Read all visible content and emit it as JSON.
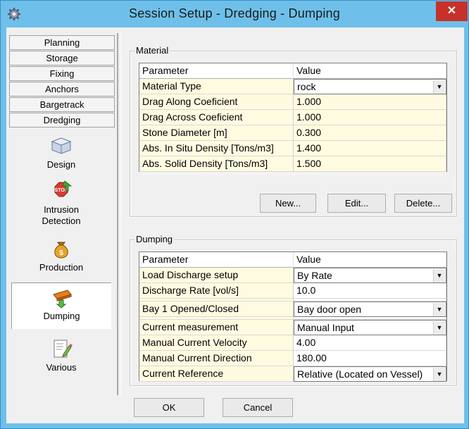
{
  "window": {
    "title": "Session Setup - Dredging -  Dumping",
    "close_glyph": "✕",
    "icon": "gear-icon"
  },
  "nav": {
    "tabs": [
      "Planning",
      "Storage",
      "Fixing",
      "Anchors",
      "Bargetrack",
      "Dredging"
    ],
    "items": [
      {
        "label": "Design",
        "icon": "design-box-icon"
      },
      {
        "label": "Intrusion\nDetection",
        "icon": "stop-sign-icon"
      },
      {
        "label": "Production",
        "icon": "money-bag-icon"
      },
      {
        "label": "Dumping",
        "icon": "dumping-arrow-icon",
        "selected": true
      },
      {
        "label": "Various",
        "icon": "pencil-checklist-icon"
      }
    ]
  },
  "material": {
    "title": "Material",
    "headers": [
      "Parameter",
      "Value"
    ],
    "rows": [
      {
        "param": "Material Type",
        "value": "rock",
        "dropdown": true
      },
      {
        "param": "Drag Along Coeficient",
        "value": "1.000"
      },
      {
        "param": "Drag Across Coeficient",
        "value": "1.000"
      },
      {
        "param": "Stone Diameter [m]",
        "value": "0.300"
      },
      {
        "param": "Abs. In Situ Density [Tons/m3]",
        "value": "1.400"
      },
      {
        "param": "Abs. Solid Density [Tons/m3]",
        "value": "1.500"
      }
    ],
    "buttons": {
      "new": "New...",
      "edit": "Edit...",
      "delete": "Delete..."
    }
  },
  "dumping": {
    "title": "Dumping",
    "headers": [
      "Parameter",
      "Value"
    ],
    "rows": [
      {
        "param": "Load Discharge setup",
        "value": "By Rate",
        "dropdown": true
      },
      {
        "param": "Discharge Rate [vol/s]",
        "value": "10.0"
      },
      {
        "param": "Bay 1 Opened/Closed",
        "value": "Bay door open",
        "dropdown": true
      },
      {
        "param": "Current measurement",
        "value": "Manual Input",
        "dropdown": true
      },
      {
        "param": "Manual Current Velocity",
        "value": "4.00"
      },
      {
        "param": "Manual Current Direction",
        "value": "180.00"
      },
      {
        "param": "Current Reference",
        "value": "Relative (Located on Vessel)",
        "dropdown": true
      }
    ]
  },
  "footer": {
    "ok": "OK",
    "cancel": "Cancel"
  },
  "colors": {
    "titlebar": "#6ec0ea",
    "close": "#c7312a",
    "param_bg": "#fffbe0",
    "selected_row": "#ffffff"
  }
}
